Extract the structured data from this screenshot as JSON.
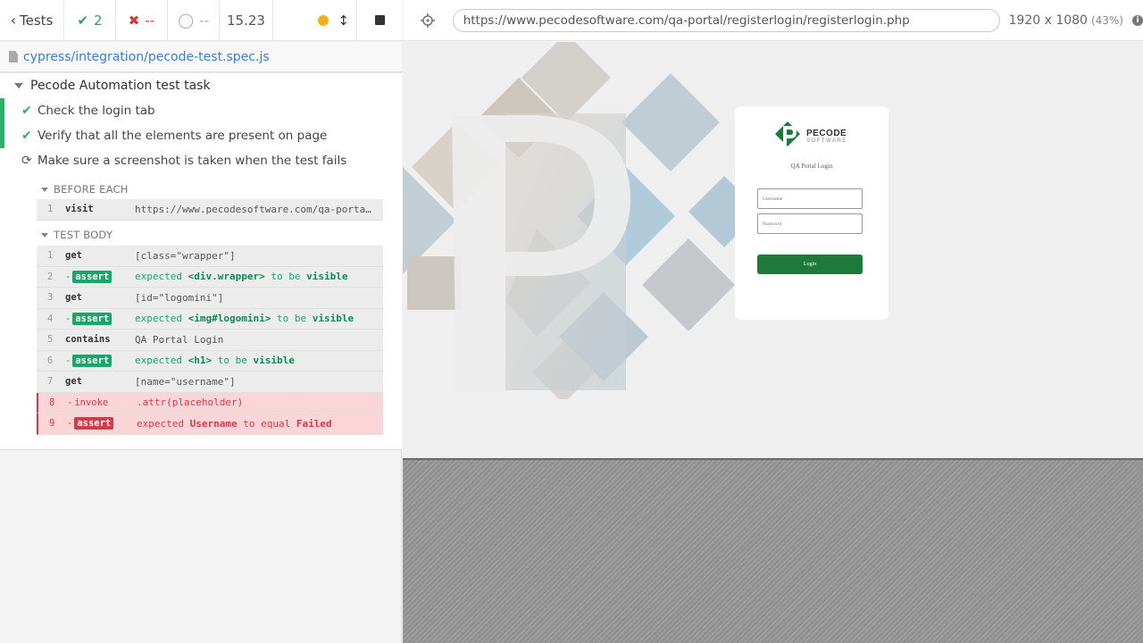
{
  "header": {
    "tests_label": "Tests",
    "passed_count": "2",
    "failed_count": "--",
    "pending_count": "--",
    "duration": "15.23"
  },
  "spec": {
    "path": "cypress/integration/pecode-test.spec.js"
  },
  "suite": {
    "title": "Pecode Automation test task",
    "tests": [
      {
        "title": "Check the login tab",
        "state": "passed"
      },
      {
        "title": "Verify that all the elements are present on page",
        "state": "passed"
      },
      {
        "title": "Make sure a screenshot is taken when the test fails",
        "state": "running"
      }
    ]
  },
  "hooks": {
    "before_each_title": "BEFORE EACH",
    "test_body_title": "TEST BODY",
    "before_each": [
      {
        "num": "1",
        "name": "visit",
        "msg": "https://www.pecodesoftware.com/qa-portal/greet..."
      }
    ],
    "test_body": [
      {
        "num": "1",
        "name": "get",
        "msg": "[class=\"wrapper\"]"
      },
      {
        "num": "2",
        "name": "assert",
        "pre": "expected",
        "subject": "<div.wrapper>",
        "mid": "to be",
        "post": "visible"
      },
      {
        "num": "3",
        "name": "get",
        "msg": "[id=\"logomini\"]"
      },
      {
        "num": "4",
        "name": "assert",
        "pre": "expected",
        "subject": "<img#logomini>",
        "mid": "to be",
        "post": "visible"
      },
      {
        "num": "5",
        "name": "contains",
        "msg": "QA Portal Login"
      },
      {
        "num": "6",
        "name": "assert",
        "pre": "expected",
        "subject": "<h1>",
        "mid": "to be",
        "post": "visible"
      },
      {
        "num": "7",
        "name": "get",
        "msg": "[name=\"username\"]"
      },
      {
        "num": "8",
        "name": "invoke",
        "msg": ".attr(placeholder)"
      },
      {
        "num": "9",
        "name": "assert",
        "pre": "expected",
        "subject": "Username",
        "mid": "to equal",
        "post": "Failed"
      }
    ]
  },
  "aut": {
    "url": "https://www.pecodesoftware.com/qa-portal/registerlogin/registerlogin.php",
    "viewport": "1920 x 1080",
    "scale": "(43%)",
    "login": {
      "brand_top": "PECODE",
      "brand_bottom": "SOFTWARE",
      "title": "QA Portal Login",
      "username_placeholder": "Username",
      "password_placeholder": "Password",
      "button_label": "Login"
    }
  },
  "colors": {
    "pass": "#2cb06b",
    "fail": "#d03c49",
    "brand": "#1d7a3a"
  }
}
